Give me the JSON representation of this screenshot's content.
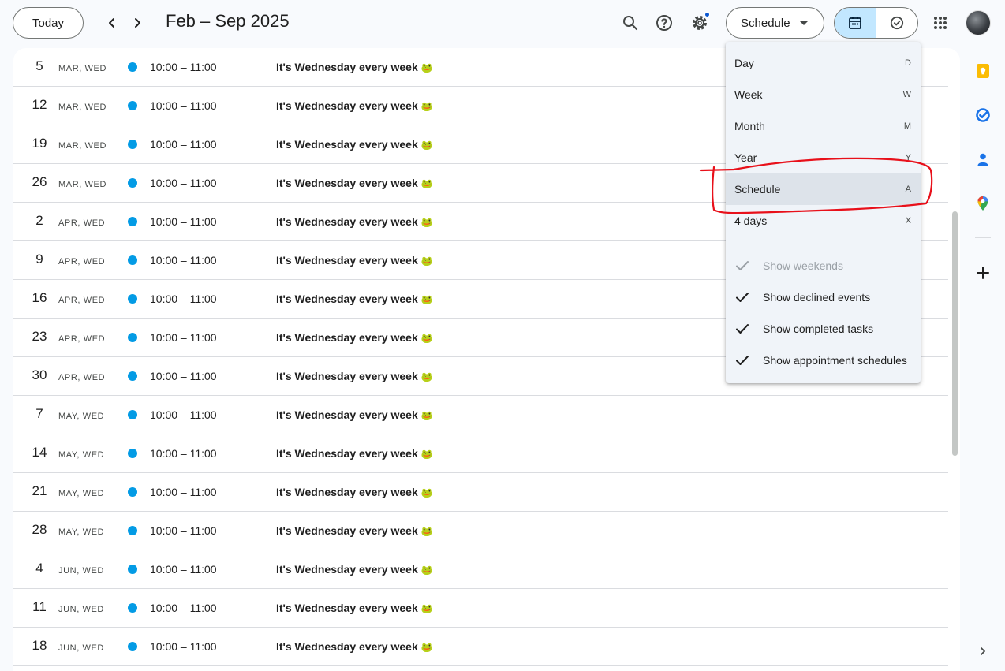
{
  "header": {
    "today_label": "Today",
    "date_range": "Feb – Sep 2025",
    "view_label": "Schedule"
  },
  "events": [
    {
      "day": "5",
      "month_weekday": "MAR, WED",
      "time": "10:00 – 11:00",
      "title": "It's Wednesday every week",
      "emoji": "🐸"
    },
    {
      "day": "12",
      "month_weekday": "MAR, WED",
      "time": "10:00 – 11:00",
      "title": "It's Wednesday every week",
      "emoji": "🐸"
    },
    {
      "day": "19",
      "month_weekday": "MAR, WED",
      "time": "10:00 – 11:00",
      "title": "It's Wednesday every week",
      "emoji": "🐸"
    },
    {
      "day": "26",
      "month_weekday": "MAR, WED",
      "time": "10:00 – 11:00",
      "title": "It's Wednesday every week",
      "emoji": "🐸"
    },
    {
      "day": "2",
      "month_weekday": "APR, WED",
      "time": "10:00 – 11:00",
      "title": "It's Wednesday every week",
      "emoji": "🐸"
    },
    {
      "day": "9",
      "month_weekday": "APR, WED",
      "time": "10:00 – 11:00",
      "title": "It's Wednesday every week",
      "emoji": "🐸"
    },
    {
      "day": "16",
      "month_weekday": "APR, WED",
      "time": "10:00 – 11:00",
      "title": "It's Wednesday every week",
      "emoji": "🐸"
    },
    {
      "day": "23",
      "month_weekday": "APR, WED",
      "time": "10:00 – 11:00",
      "title": "It's Wednesday every week",
      "emoji": "🐸"
    },
    {
      "day": "30",
      "month_weekday": "APR, WED",
      "time": "10:00 – 11:00",
      "title": "It's Wednesday every week",
      "emoji": "🐸"
    },
    {
      "day": "7",
      "month_weekday": "MAY, WED",
      "time": "10:00 – 11:00",
      "title": "It's Wednesday every week",
      "emoji": "🐸"
    },
    {
      "day": "14",
      "month_weekday": "MAY, WED",
      "time": "10:00 – 11:00",
      "title": "It's Wednesday every week",
      "emoji": "🐸"
    },
    {
      "day": "21",
      "month_weekday": "MAY, WED",
      "time": "10:00 – 11:00",
      "title": "It's Wednesday every week",
      "emoji": "🐸"
    },
    {
      "day": "28",
      "month_weekday": "MAY, WED",
      "time": "10:00 – 11:00",
      "title": "It's Wednesday every week",
      "emoji": "🐸"
    },
    {
      "day": "4",
      "month_weekday": "JUN, WED",
      "time": "10:00 – 11:00",
      "title": "It's Wednesday every week",
      "emoji": "🐸"
    },
    {
      "day": "11",
      "month_weekday": "JUN, WED",
      "time": "10:00 – 11:00",
      "title": "It's Wednesday every week",
      "emoji": "🐸"
    },
    {
      "day": "18",
      "month_weekday": "JUN, WED",
      "time": "10:00 – 11:00",
      "title": "It's Wednesday every week",
      "emoji": "🐸"
    }
  ],
  "view_menu": {
    "items": [
      {
        "label": "Day",
        "shortcut": "D"
      },
      {
        "label": "Week",
        "shortcut": "W"
      },
      {
        "label": "Month",
        "shortcut": "M"
      },
      {
        "label": "Year",
        "shortcut": "Y"
      },
      {
        "label": "Schedule",
        "shortcut": "A"
      },
      {
        "label": "4 days",
        "shortcut": "X"
      }
    ],
    "selected": "Schedule",
    "options": [
      {
        "label": "Show weekends",
        "checked": true,
        "disabled": true
      },
      {
        "label": "Show declined events",
        "checked": true,
        "disabled": false
      },
      {
        "label": "Show completed tasks",
        "checked": true,
        "disabled": false
      },
      {
        "label": "Show appointment schedules",
        "checked": true,
        "disabled": false
      }
    ]
  },
  "side_panel": {
    "apps": [
      "keep-icon",
      "tasks-icon",
      "contacts-icon",
      "maps-icon",
      "add-icon"
    ]
  },
  "colors": {
    "event_dot": "#039be5",
    "active_segment": "#c2e7ff",
    "menu_background": "#f0f4f9",
    "annotation": "#e8101a"
  }
}
